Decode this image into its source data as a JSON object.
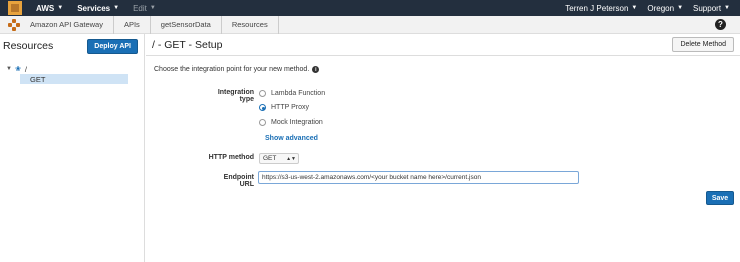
{
  "topbar": {
    "aws_label": "AWS",
    "services_label": "Services",
    "edit_label": "Edit",
    "user_label": "Terren J Peterson",
    "region_label": "Oregon",
    "support_label": "Support"
  },
  "breadcrumb": {
    "service": "Amazon API Gateway",
    "apis": "APIs",
    "api_name": "getSensorData",
    "section": "Resources"
  },
  "left_panel": {
    "title": "Resources",
    "deploy_label": "Deploy API",
    "tree_root": "/",
    "tree_child": "GET"
  },
  "main": {
    "title": "/ - GET - Setup",
    "delete_label": "Delete Method",
    "intro": "Choose the integration point for your new method.",
    "integration_label": "Integration type",
    "options": [
      "Lambda Function",
      "HTTP Proxy",
      "Mock Integration"
    ],
    "selected_option": "HTTP Proxy",
    "show_advanced": "Show advanced",
    "http_method_label": "HTTP method",
    "http_method_value": "GET",
    "endpoint_label": "Endpoint URL",
    "endpoint_value": "https://s3-us-west-2.amazonaws.com/<your bucket name here>/current.json",
    "save_label": "Save"
  },
  "colors": {
    "accent": "#1a6fb5",
    "topbar_bg": "#232f3e",
    "selected_row": "#cfe3f5"
  },
  "icons": [
    "aws-logo-icon",
    "api-gateway-icon",
    "help-icon",
    "resource-icon",
    "info-icon",
    "caret-down-icon"
  ]
}
